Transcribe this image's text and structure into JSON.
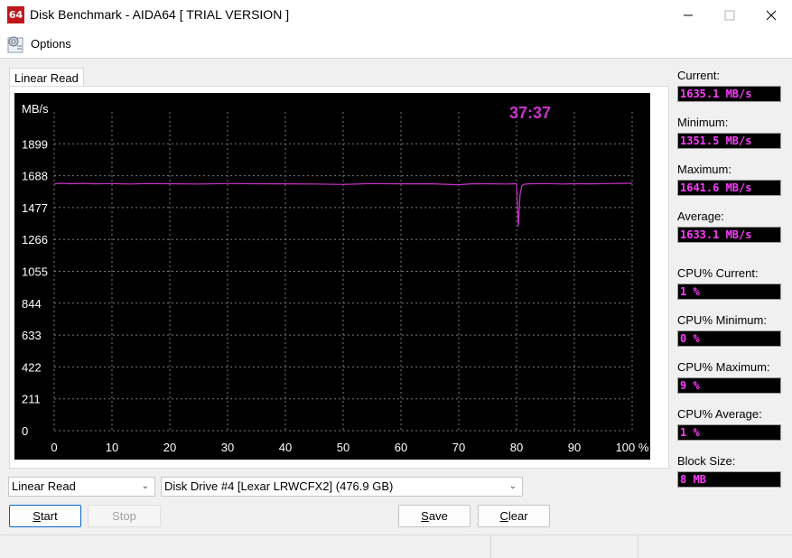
{
  "window": {
    "app_icon_text": "64",
    "title": "Disk Benchmark - AIDA64  [ TRIAL VERSION ]"
  },
  "menu": {
    "options_label": "Options"
  },
  "tab": {
    "label": "Linear Read"
  },
  "chart_data": {
    "type": "line",
    "ylabel": "MB/s",
    "timer": "37:37",
    "y_ticks": [
      "1899",
      "1688",
      "1477",
      "1266",
      "1055",
      "844",
      "633",
      "422",
      "211",
      "0"
    ],
    "x_ticks": [
      "0",
      "10",
      "20",
      "30",
      "40",
      "50",
      "60",
      "70",
      "80",
      "90",
      "100 %"
    ],
    "ylim": [
      0,
      2110
    ],
    "xlim": [
      0,
      100
    ],
    "grid": true,
    "series": [
      {
        "color": "#cc33cc",
        "x": [
          0,
          1,
          3,
          5,
          7,
          10,
          13,
          16,
          20,
          25,
          30,
          35,
          40,
          45,
          50,
          55,
          60,
          65,
          70,
          72,
          75,
          78,
          80,
          80.3,
          80.6,
          80.9,
          81.2,
          82,
          85,
          88,
          90,
          93,
          96,
          100
        ],
        "y": [
          1633,
          1638,
          1635,
          1637,
          1634,
          1636,
          1633,
          1636,
          1635,
          1633,
          1636,
          1635,
          1634,
          1633,
          1630,
          1636,
          1634,
          1635,
          1628,
          1634,
          1635,
          1633,
          1635,
          1352,
          1560,
          1620,
          1630,
          1634,
          1636,
          1633,
          1635,
          1634,
          1636,
          1638
        ]
      }
    ]
  },
  "stats": [
    {
      "label": "Current:",
      "value": "1635.1 MB/s"
    },
    {
      "label": "Minimum:",
      "value": "1351.5 MB/s"
    },
    {
      "label": "Maximum:",
      "value": "1641.6 MB/s"
    },
    {
      "label": "Average:",
      "value": "1633.1 MB/s"
    },
    {
      "label": "CPU% Current:",
      "value": "1 %"
    },
    {
      "label": "CPU% Minimum:",
      "value": "0 %"
    },
    {
      "label": "CPU% Maximum:",
      "value": "9 %"
    },
    {
      "label": "CPU% Average:",
      "value": "1 %"
    },
    {
      "label": "Block Size:",
      "value": "8 MB"
    }
  ],
  "controls": {
    "test_select": "Linear Read",
    "drive_select": "Disk Drive #4  [Lexar   LRWCFX2]  (476.9 GB)",
    "start_label": "Start",
    "stop_label": "Stop",
    "save_label": "Save",
    "clear_label": "Clear"
  },
  "colors": {
    "stat_text": "#ff3cff",
    "timer": "#cc33cc",
    "series": "#cc33cc"
  }
}
